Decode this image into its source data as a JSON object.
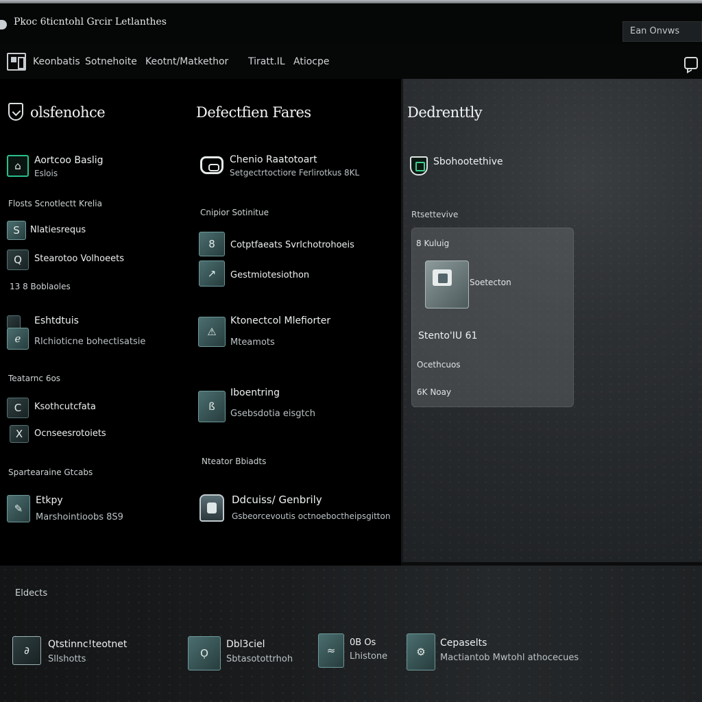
{
  "window": {
    "title": "Pkoc 6ticntohl Grcir Letlanthes",
    "account_button": "Ean Onvws"
  },
  "menu": {
    "items": [
      "Keonbatis",
      "Sotnehoite",
      "Keotnt/Matkethor",
      "Tiratt.IL",
      "Atiocpe"
    ]
  },
  "left_column": {
    "heading": "olsfenohce",
    "featured": {
      "title": "Aortcoo Baslig",
      "sub": "Eslois"
    },
    "section1_label": "Flosts Scnotlectt Krelia",
    "items1": [
      {
        "title": "Nlatiesrequs",
        "icon": "S"
      },
      {
        "title": "Stearotoo Volhoeets",
        "icon": "Q"
      }
    ],
    "section1b_label": "13 8 Boblaoles",
    "item_stats": {
      "title": "Eshtdtuis",
      "sub": "Rlchioticne bohectisatsie"
    },
    "section2_label": "Teatarnc 6os",
    "items2": [
      {
        "title": "Ksothcutcfata",
        "icon": "C"
      },
      {
        "title": "Ocnseesrotoiets",
        "icon": "X"
      }
    ],
    "section3_label": "Spartearaine Gtcabs",
    "item_last": {
      "title": "Etkpy",
      "sub": "Marshointioobs 8S9"
    }
  },
  "center_column": {
    "heading": "Defectfien Fares",
    "featured": {
      "title": "Chenio Raatotoart",
      "sub": "Setgectrtoctiore Ferlirotkus 8KL"
    },
    "section1_label": "Cnipior Sotinitue",
    "items1": [
      {
        "title": "Cotptfaeats Svrlchotrohoeis",
        "icon": "8"
      },
      {
        "title": "Gestmiotesiothon",
        "icon": "↗"
      }
    ],
    "group2": {
      "title": "Ktonectcol Mlefiorter",
      "sub": "Mteamots"
    },
    "group3": {
      "title": "Iboentring",
      "sub": "Gsebsdotia eisgtch"
    },
    "section2_label": "Nteator Bbiadts",
    "item_last": {
      "title": "Ddcuiss/ Genbrily",
      "sub": "Gsbeorcevoutis octnoeboctheipsgitton"
    }
  },
  "right_column": {
    "heading": "Dedrenttly",
    "featured": {
      "title": "Sbohootethive"
    },
    "section_label": "Rtsettevive",
    "card": {
      "row1": "8 Kuluig",
      "tile_label": "Soetecton",
      "row2": "Stento'IU 61",
      "row3": "Ocethcuos",
      "row4": "6K Noay"
    }
  },
  "bottom": {
    "label": "Eldects",
    "items": [
      {
        "title": "Qtstinnc!teotnet",
        "sub": "Sllshotts"
      },
      {
        "title": "Dbl3ciel",
        "sub": "Sbtasotottrhoh"
      },
      {
        "title": "0B Os",
        "sub": "Lhistone"
      },
      {
        "title": "Cepaselts",
        "sub": "Mactiantob Mwtohl athocecues"
      }
    ]
  },
  "colors": {
    "accent_green": "#27c28a",
    "teal_tile": "#4b6e6f",
    "background": "#000000"
  }
}
